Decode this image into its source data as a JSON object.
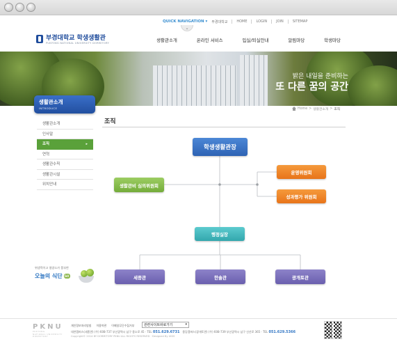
{
  "top_nav": {
    "quick_navigation": "QUICK NAVIGATION ▾",
    "links": [
      "부경대학교",
      "HOME",
      "LOGIN",
      "JOIN",
      "SITEMAP"
    ]
  },
  "logo": {
    "name": "부경대학교 학생생활관",
    "subtitle": "PUKYONG NATIONAL UNIVERSITY DORMITORY"
  },
  "gnb": [
    "생활관소개",
    "온라인 서비스",
    "입실/퇴실안내",
    "알림마당",
    "학생마당"
  ],
  "hero": {
    "line1": "밝은 내일을 준비하는",
    "line2": "또 다른 꿈의 공간"
  },
  "sidebar": {
    "title": "생활관소개",
    "title_en": "INTRODUCE",
    "items": [
      {
        "label": "생활관소개"
      },
      {
        "label": "인사말"
      },
      {
        "label": "조직",
        "active": true
      },
      {
        "label": "연혁"
      },
      {
        "label": "생활관수칙"
      },
      {
        "label": "생활관시설"
      },
      {
        "label": "위치안내"
      }
    ],
    "banner": {
      "small": "위생적이고 영양소가 풍부한",
      "big": "오늘의 식단",
      "go": "GO"
    }
  },
  "breadcrumb": {
    "home": "Home",
    "sep1": ">",
    "section": "생활관소개",
    "sep2": ">",
    "current": "조직"
  },
  "content": {
    "title": "조직"
  },
  "org": {
    "head": "학생생활관장",
    "committee": "생활관비 심의위원회",
    "operation": "운영위원회",
    "evaluation": "성과평가 위원회",
    "admin": "행정실장",
    "dorms": [
      "세종관",
      "한솔관",
      "광개토관"
    ]
  },
  "footer": {
    "logo": "PKNU",
    "logo_sub": [
      "PUKYONG",
      "NATIONAL UNIVERSITY",
      "DORMITORY"
    ],
    "links": [
      "개인정보처리방침",
      "이용약관",
      "이메일무단수집거부"
    ],
    "related_select": "관련사이트바로가기",
    "address_1": "대연캠퍼스(세종관)",
    "address_1_detail": "(우) 608-737 부산광역시 남구 용소로 45 · TEL",
    "phone_1": "051.629.6731",
    "address_2": "용당캠퍼스(광개토관)",
    "address_2_detail": "(우) 608-739 부산광역시 남구 신선로 365 · TEL",
    "phone_2": "051.629.5366",
    "copyright": "Copyright© 2014 BY DORMITORY PKNU ALL RIGHTS RESERVED · Designed By UIDS"
  },
  "colors": {
    "head": "#2e63b4",
    "green": "#74ac3a",
    "orange": "#e8741a",
    "teal": "#33a7ad",
    "purple": "#6a5fae",
    "menu_active": "#5aa13a"
  }
}
